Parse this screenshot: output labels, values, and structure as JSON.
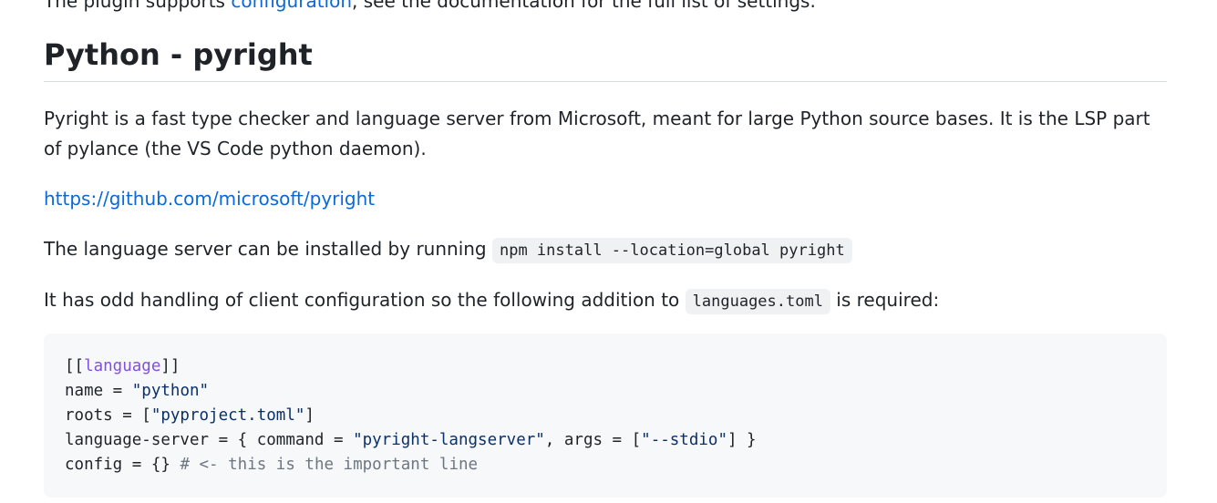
{
  "top_partial": {
    "before": "The plugin supports",
    "link": "configuration",
    "after": ", see the documentation for the full list of settings."
  },
  "section": {
    "title": "Python - pyright"
  },
  "para1": "Pyright is a fast type checker and language server from Microsoft, meant for large Python source bases. It is the LSP part of pylance (the VS Code python daemon).",
  "repo_link": "https://github.com/microsoft/pyright",
  "para3": {
    "text": "The language server can be installed by running ",
    "code": "npm install --location=global pyright"
  },
  "para4": {
    "before": "It has odd handling of client configuration so the following addition to ",
    "code": "languages.toml",
    "after": " is required:"
  },
  "code_block": {
    "l1_open": "[[",
    "l1_kw": "language",
    "l1_close": "]]",
    "l2_key": "name = ",
    "l2_str": "\"python\"",
    "l3_key": "roots = [",
    "l3_str": "\"pyproject.toml\"",
    "l3_end": "]",
    "l4_key": "language-server = { command = ",
    "l4_str1": "\"pyright-langserver\"",
    "l4_mid": ", args = [",
    "l4_str2": "\"--stdio\"",
    "l4_end": "] }",
    "l5_key": "config = {} ",
    "l5_cmt": "# <- this is the important line"
  },
  "colors": {
    "link": "#0969da",
    "text": "#1f2328",
    "keyword": "#8250df",
    "string": "#0a3069",
    "comment": "#6e7781",
    "code_bg": "#f6f8fa"
  }
}
